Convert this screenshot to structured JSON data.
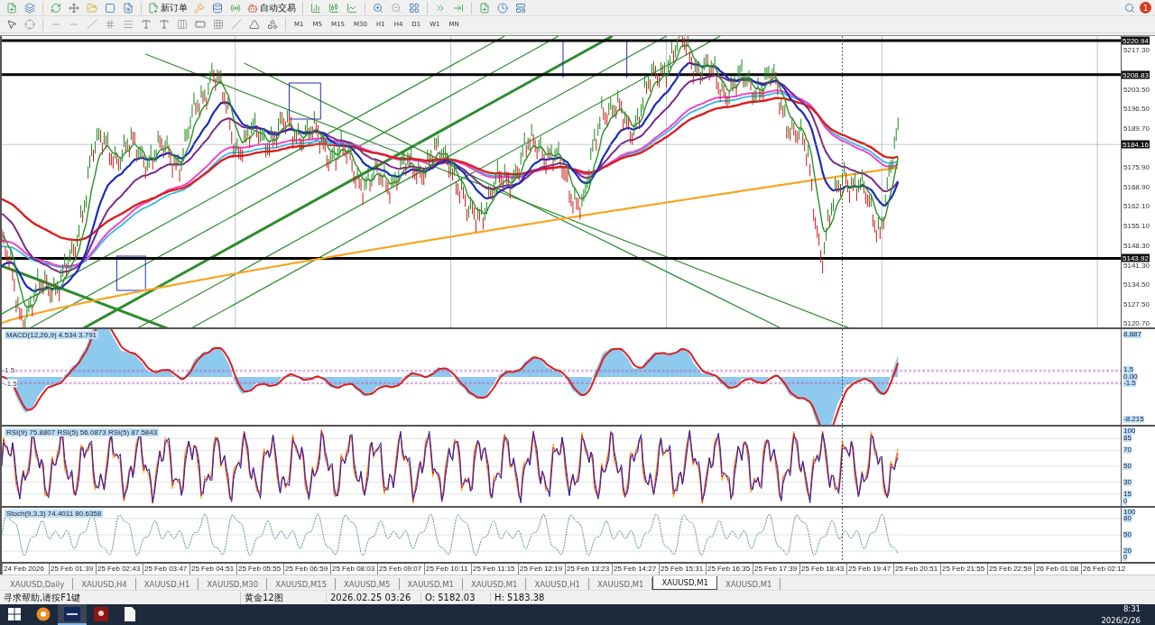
{
  "toolbar": {
    "new_order": "新订单",
    "auto_trading": "自动交易",
    "notification_count": "1"
  },
  "timeframes": [
    {
      "label": "M1",
      "selected": false
    },
    {
      "label": "M5",
      "selected": false
    },
    {
      "label": "M15",
      "selected": false
    },
    {
      "label": "M30",
      "selected": false
    },
    {
      "label": "H1",
      "selected": false
    },
    {
      "label": "H4",
      "selected": false
    },
    {
      "label": "D1",
      "selected": false
    },
    {
      "label": "W1",
      "selected": false
    },
    {
      "label": "MN",
      "selected": false
    }
  ],
  "main_chart": {
    "price_labels": [
      "5217.30",
      "5203.50",
      "5196.50",
      "5189.70",
      "5175.90",
      "5168.90",
      "5162.10",
      "5155.10",
      "5148.30",
      "5141.30",
      "5134.50",
      "5127.50",
      "5120.70"
    ],
    "price_markers": [
      "5220.94",
      "5208.83",
      "5184.16",
      "5143.92"
    ]
  },
  "macd": {
    "title": "MACD(12,26,9) 4.534 3.791",
    "axis_labels": [
      "8.887",
      "1.5",
      "0.00",
      "-1.5",
      "-8.215"
    ],
    "level_labels": [
      "1.5",
      "-1.5"
    ]
  },
  "rsi": {
    "title": "RSI(9) 75.8807 RSI(5) 56.0873 RSI(5) 87.5843",
    "axis_labels": [
      "100",
      "85",
      "70",
      "50",
      "30",
      "15",
      "0"
    ]
  },
  "stoch": {
    "title": "Stoch(9,3,3) 74.4011 80.6358",
    "axis_labels": [
      "100",
      "80",
      "50",
      "20",
      "0"
    ]
  },
  "time_axis": [
    "24 Feb 2026",
    "25 Feb 01:39",
    "25 Feb 02:43",
    "25 Feb 03:47",
    "25 Feb 04:51",
    "25 Feb 05:55",
    "25 Feb 06:59",
    "25 Feb 08:03",
    "25 Feb 09:07",
    "25 Feb 10:11",
    "25 Feb 11:15",
    "25 Feb 12:19",
    "25 Feb 13:23",
    "25 Feb 14:27",
    "25 Feb 15:31",
    "25 Feb 16:35",
    "25 Feb 17:39",
    "25 Feb 18:43",
    "25 Feb 19:47",
    "25 Feb 20:51",
    "25 Feb 21:55",
    "25 Feb 22:59",
    "26 Feb 01:08",
    "26 Feb 02:12"
  ],
  "chart_tabs": [
    {
      "label": "XAUUSD,Daily",
      "selected": false
    },
    {
      "label": "XAUUSD,H4",
      "selected": false
    },
    {
      "label": "XAUUSD,H1",
      "selected": false
    },
    {
      "label": "XAUUSD,M30",
      "selected": false
    },
    {
      "label": "XAUUSD,M15",
      "selected": false
    },
    {
      "label": "XAUUSD,M5",
      "selected": false
    },
    {
      "label": "XAUUSD,M1",
      "selected": false
    },
    {
      "label": "XAUUSD,M1",
      "selected": false
    },
    {
      "label": "XAUUSD,H1",
      "selected": false
    },
    {
      "label": "XAUUSD,M1",
      "selected": false
    },
    {
      "label": "XAUUSD,M1",
      "selected": true
    },
    {
      "label": "XAUUSD,M1",
      "selected": false
    }
  ],
  "status_bar": {
    "help": "寻求帮助,请按F1键",
    "profile": "黄金12图",
    "datetime": "2026.02.25 03:26",
    "open": "O: 5182.03",
    "high": "H: 5183.38"
  },
  "taskbar": {
    "apps": [
      {
        "kind": "browser",
        "selected": false
      },
      {
        "kind": "kvb",
        "selected": true
      },
      {
        "kind": "trader",
        "selected": false
      },
      {
        "kind": "document",
        "selected": false
      }
    ],
    "time": "8:31",
    "date": "2026/2/26"
  }
}
